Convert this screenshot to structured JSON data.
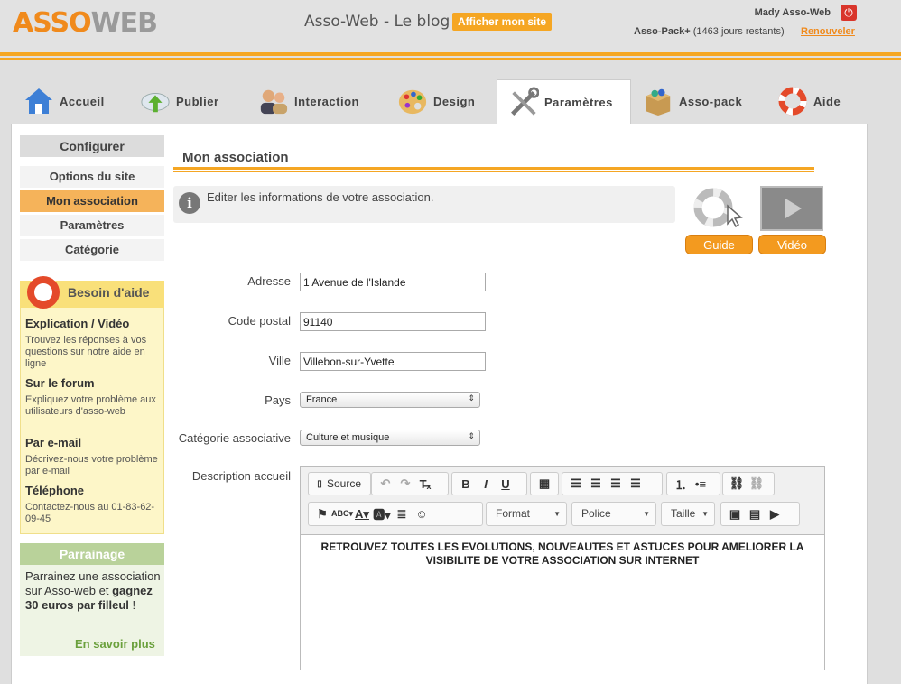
{
  "header": {
    "logo_a": "ASSO",
    "logo_b": "WEB",
    "blog_title": "Asso-Web - Le blog",
    "show_site": "Afficher mon site",
    "user": "Mady Asso-Web",
    "pack_name": "Asso-Pack+",
    "pack_days": "(1463 jours restants)",
    "renew": "Renouveler",
    "accent": "#f5a623"
  },
  "tabs": [
    {
      "label": "Accueil",
      "icon": "house-icon"
    },
    {
      "label": "Publier",
      "icon": "cloud-upload-icon"
    },
    {
      "label": "Interaction",
      "icon": "users-icon"
    },
    {
      "label": "Design",
      "icon": "palette-icon"
    },
    {
      "label": "Paramètres",
      "icon": "tools-icon",
      "active": true
    },
    {
      "label": "Asso-pack",
      "icon": "box-icon"
    },
    {
      "label": "Aide",
      "icon": "lifebuoy-icon"
    }
  ],
  "sidebar": {
    "head": "Configurer",
    "items": [
      {
        "label": "Options du site"
      },
      {
        "label": "Mon association",
        "active": true
      },
      {
        "label": "Paramètres"
      },
      {
        "label": "Catégorie"
      }
    ]
  },
  "help": {
    "title": "Besoin d'aide",
    "sections": [
      {
        "title": "Explication / Vidéo",
        "text": "Trouvez les réponses à vos questions sur notre aide en ligne"
      },
      {
        "title": "Sur le forum",
        "text": "Expliquez votre problème aux utilisateurs d'asso-web"
      },
      {
        "title": "Par e-mail",
        "text": "Décrivez-nous votre problème par e-mail"
      },
      {
        "title": "Téléphone",
        "text": "Contactez-nous au 01-83-62-09-45"
      }
    ]
  },
  "parrainage": {
    "title": "Parrainage",
    "t1": "Parrainez une association sur Asso-web et ",
    "t2": "gagnez 30 euros par filleul",
    "t3": " !",
    "more": "En savoir plus"
  },
  "main": {
    "title": "Mon association",
    "info": "Editer les informations de votre association.",
    "guide": "Guide",
    "video": "Vidéo"
  },
  "form": {
    "adresse_label": "Adresse",
    "adresse": "1 Avenue de l'Islande",
    "cp_label": "Code postal",
    "cp": "91140",
    "ville_label": "Ville",
    "ville": "Villebon-sur-Yvette",
    "pays_label": "Pays",
    "pays": "France",
    "cat_label": "Catégorie associative",
    "cat": "Culture et musique",
    "desc_label": "Description accueil"
  },
  "editor": {
    "source": "Source",
    "format": "Format",
    "police": "Police",
    "taille": "Taille",
    "content": "RETROUVEZ TOUTES LES EVOLUTIONS, NOUVEAUTES ET ASTUCES POUR AMELIORER LA VISIBILITE DE VOTRE ASSOCIATION SUR INTERNET"
  }
}
